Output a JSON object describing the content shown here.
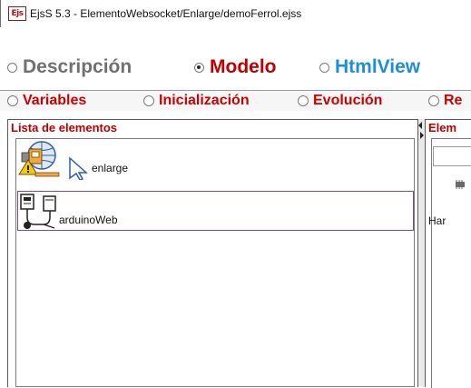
{
  "window": {
    "app_icon_text": "Ejs",
    "title": "EjsS 5.3 - ElementoWebsocket/Enlarge/demoFerrol.ejss"
  },
  "main_tabs": [
    {
      "label": "Descripción",
      "selected": false,
      "color": "#707070"
    },
    {
      "label": "Modelo",
      "selected": true,
      "color": "#c00000"
    },
    {
      "label": "HtmlView",
      "selected": false,
      "color": "#1e8fd6"
    }
  ],
  "sub_tabs": [
    {
      "label": "Variables",
      "selected": false
    },
    {
      "label": "Inicialización",
      "selected": false
    },
    {
      "label": "Evolución",
      "selected": false
    },
    {
      "label": "Re",
      "selected": false
    }
  ],
  "left_panel": {
    "header": "Lista de elementos",
    "items": [
      {
        "label": "enlarge",
        "icon": "enlarge-icon",
        "selected": false
      },
      {
        "label": "arduinoWeb",
        "icon": "arduino-device-icon",
        "selected": true
      }
    ]
  },
  "right_panel": {
    "header": "Elem",
    "item_label": "Har",
    "icon": "chip-icon"
  },
  "colors": {
    "accent_red": "#c00000",
    "accent_blue": "#1e8fd6",
    "selection_border": "#6a4ea8"
  }
}
